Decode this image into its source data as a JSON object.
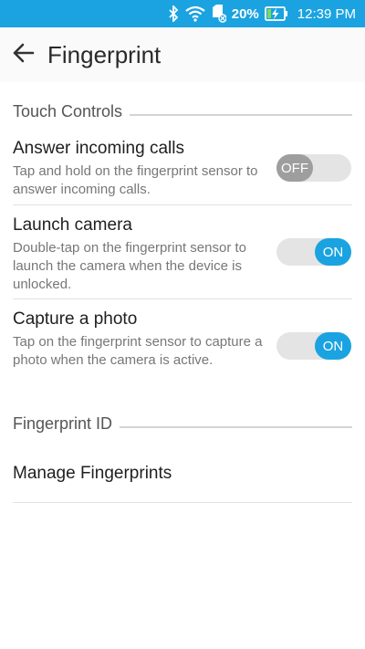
{
  "status_bar": {
    "battery_percent": "20%",
    "time": "12:39 PM",
    "icons": [
      "bluetooth-icon",
      "wifi-icon",
      "sim-card-icon",
      "battery-charging-icon"
    ],
    "bar_color": "#1aa3e0"
  },
  "app_bar": {
    "title": "Fingerprint",
    "back_icon": "arrow-left-icon"
  },
  "sections": {
    "touch_controls": "Touch Controls",
    "fingerprint_id": "Fingerprint ID"
  },
  "settings": [
    {
      "title": "Answer incoming calls",
      "summary": "Tap and hold on the fingerprint sensor to answer incoming calls.",
      "toggle_label": "OFF",
      "enabled": false
    },
    {
      "title": "Launch camera",
      "summary": "Double-tap on the fingerprint sensor to launch the camera when the device is unlocked.",
      "toggle_label": "ON",
      "enabled": true
    },
    {
      "title": "Capture a photo",
      "summary": "Tap on the fingerprint sensor to capture a photo when the camera is active.",
      "toggle_label": "ON",
      "enabled": true
    }
  ],
  "manage_fingerprints": "Manage Fingerprints",
  "colors": {
    "accent": "#1aa3e0",
    "toggle_off": "#9e9e9e",
    "toggle_track": "#e4e4e4"
  }
}
